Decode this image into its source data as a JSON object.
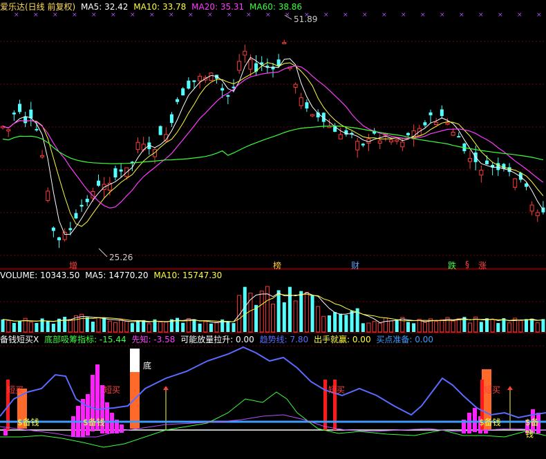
{
  "main": {
    "title": "爱乐达(日线 前复权)",
    "ma5": "MA5: 32.42",
    "ma10": "MA10: 33.78",
    "ma20": "MA20: 35.31",
    "ma60": "MA60: 38.86",
    "high_label": "51.89",
    "low_label": "25.26",
    "markers": [
      "增",
      "榜",
      "财",
      "跌",
      "§",
      "涨"
    ]
  },
  "volume": {
    "label": "VOLUME: 10343.50",
    "ma5": "MA5: 14770.20",
    "ma10": "MA10: 15747.30"
  },
  "indicator": {
    "name": "备钱短买X",
    "dibu": "底部吸筹指标: -15.44",
    "xianzhi": "先知: -3.58",
    "kenengfang": "可能放量拉升: 0.00",
    "qushi": "趋势线: 7.80",
    "chushou": "出手就赢: 0.00",
    "maidian": "买点准备: 0.00",
    "labels_beiqian": [
      "$备钱",
      "$备钱",
      "$备钱",
      "$备钱"
    ],
    "labels_duanmai": [
      "短买",
      "短买",
      "短买",
      "短买"
    ],
    "label_di": "底"
  },
  "colors": {
    "up": "#ff3b3b",
    "down": "#54ffff",
    "ma5": "#ffffff",
    "ma10": "#ffff3c",
    "ma20": "#ff3cff",
    "ma60": "#3cff3c",
    "blue": "#5a6cff"
  }
}
